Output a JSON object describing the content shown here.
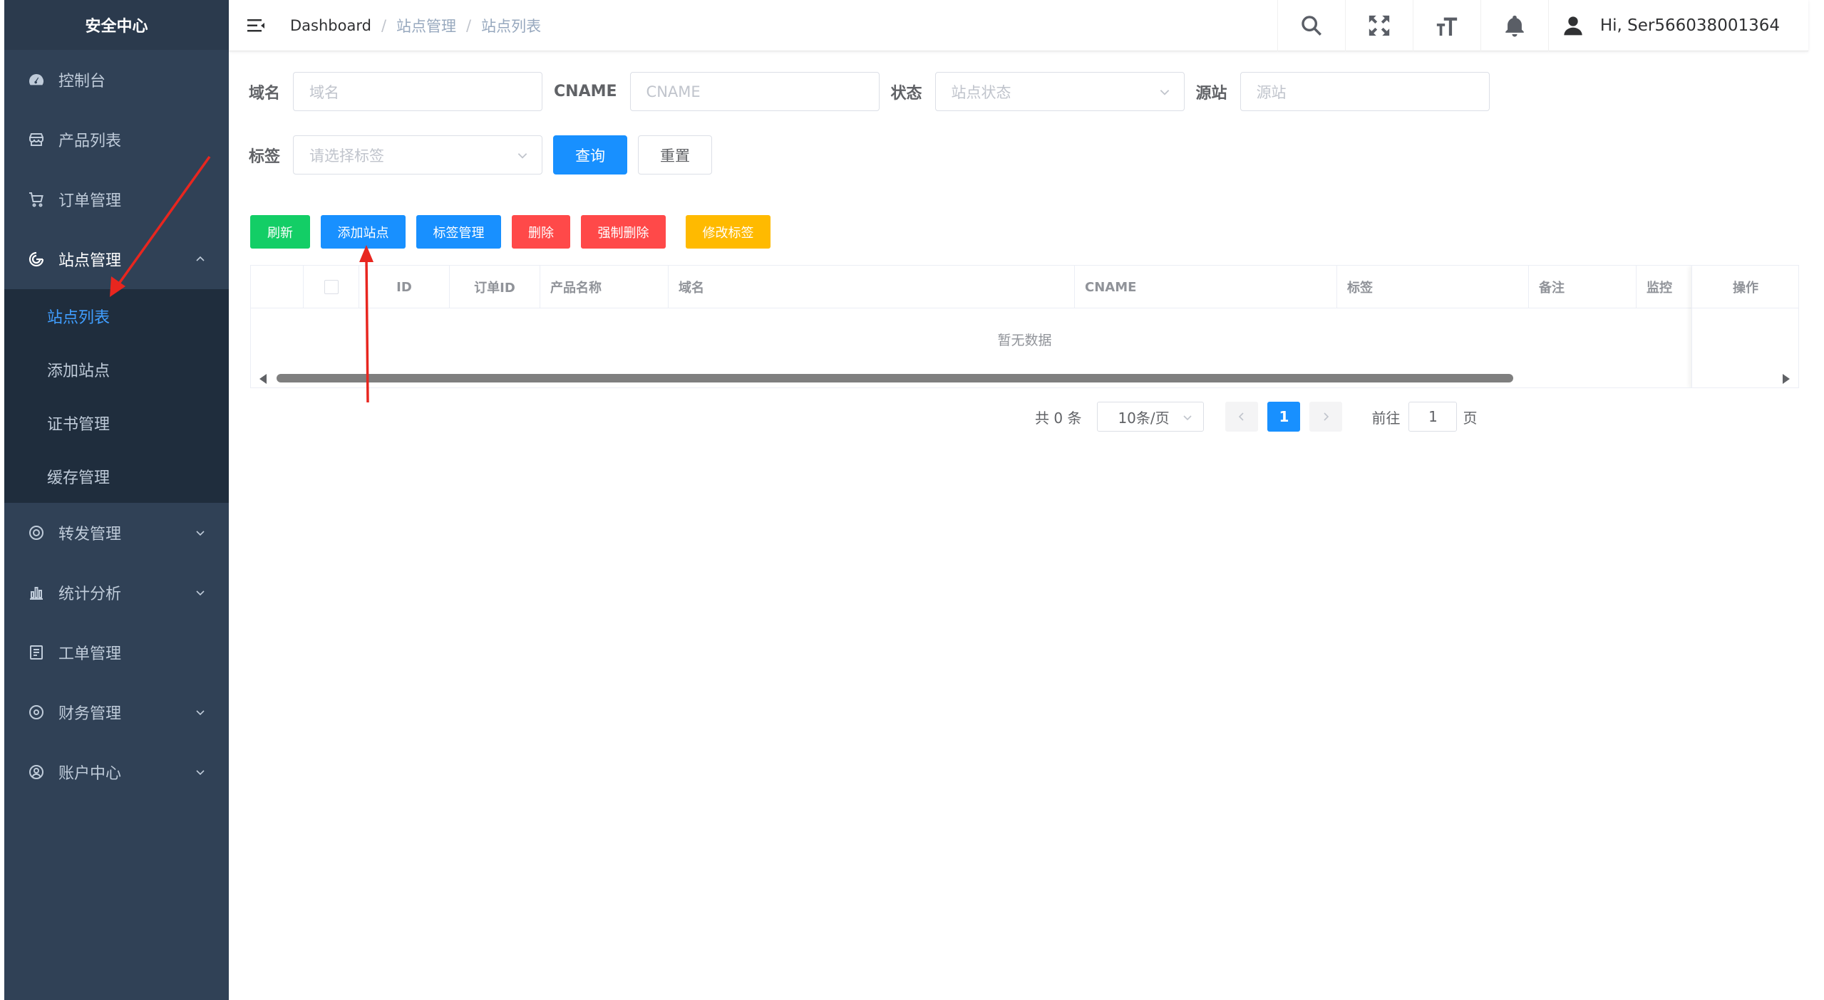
{
  "sidebar": {
    "title": "安全中心",
    "items": [
      {
        "label": "控制台",
        "icon": "dashboard-icon"
      },
      {
        "label": "产品列表",
        "icon": "store-icon"
      },
      {
        "label": "订单管理",
        "icon": "cart-icon"
      },
      {
        "label": "站点管理",
        "icon": "site-icon",
        "expanded": true
      },
      {
        "label": "转发管理",
        "icon": "forward-icon"
      },
      {
        "label": "统计分析",
        "icon": "chart-icon"
      },
      {
        "label": "工单管理",
        "icon": "ticket-icon"
      },
      {
        "label": "财务管理",
        "icon": "finance-icon"
      },
      {
        "label": "账户中心",
        "icon": "account-icon"
      }
    ],
    "sub_items": [
      {
        "label": "站点列表",
        "active": true
      },
      {
        "label": "添加站点"
      },
      {
        "label": "证书管理"
      },
      {
        "label": "缓存管理"
      }
    ]
  },
  "navbar": {
    "breadcrumb": [
      "Dashboard",
      "站点管理",
      "站点列表"
    ],
    "separator": "/",
    "user": "Hi, Ser566038001364"
  },
  "filters": {
    "domain_label": "域名",
    "domain_placeholder": "域名",
    "cname_label": "CNAME",
    "cname_placeholder": "CNAME",
    "status_label": "状态",
    "status_placeholder": "站点状态",
    "origin_label": "源站",
    "origin_placeholder": "源站",
    "tag_label": "标签",
    "tag_placeholder": "请选择标签",
    "search_button": "查询",
    "reset_button": "重置"
  },
  "toolbar": {
    "refresh": "刷新",
    "add_site": "添加站点",
    "tag_manage": "标签管理",
    "delete": "删除",
    "force_delete": "强制删除",
    "edit_tags": "修改标签"
  },
  "colors": {
    "sidebar_bg": "#304156",
    "primary": "#1890ff",
    "success": "#13ce66",
    "danger": "#ff4949",
    "warning": "#ffba00",
    "annotation": "#e8261f"
  },
  "table": {
    "columns": [
      "ID",
      "订单ID",
      "产品名称",
      "域名",
      "CNAME",
      "标签",
      "备注",
      "监控"
    ],
    "fixed_column": "操作",
    "empty_text": "暂无数据"
  },
  "pagination": {
    "total": "共 0 条",
    "page_size": "10条/页",
    "current_page": "1",
    "goto_label": "前往",
    "goto_value": "1",
    "page_suffix": "页"
  }
}
